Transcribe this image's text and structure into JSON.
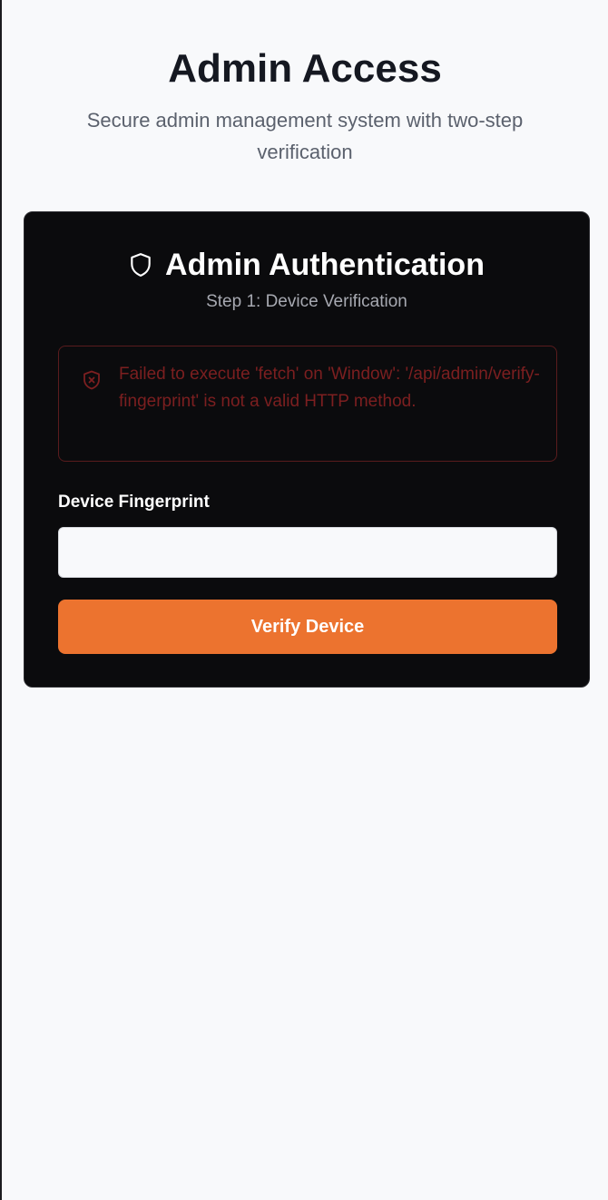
{
  "header": {
    "title": "Admin Access",
    "subtitle": "Secure admin management system with two-step verification"
  },
  "auth_card": {
    "title_icon": "shield-icon",
    "title": "Admin Authentication",
    "step": "Step 1: Device Verification",
    "error": {
      "icon": "shield-x-icon",
      "message": "Failed to execute 'fetch' on 'Window': '/api/admin/verify-fingerprint' is not a valid HTTP method."
    },
    "fingerprint": {
      "label": "Device Fingerprint",
      "value": "",
      "placeholder": ""
    },
    "verify_button_label": "Verify Device"
  },
  "colors": {
    "page_background": "#f8f9fb",
    "card_background": "#0b0b0d",
    "accent": "#ec732f",
    "error_text": "#7c1f20",
    "error_border": "#5a1c1d"
  }
}
